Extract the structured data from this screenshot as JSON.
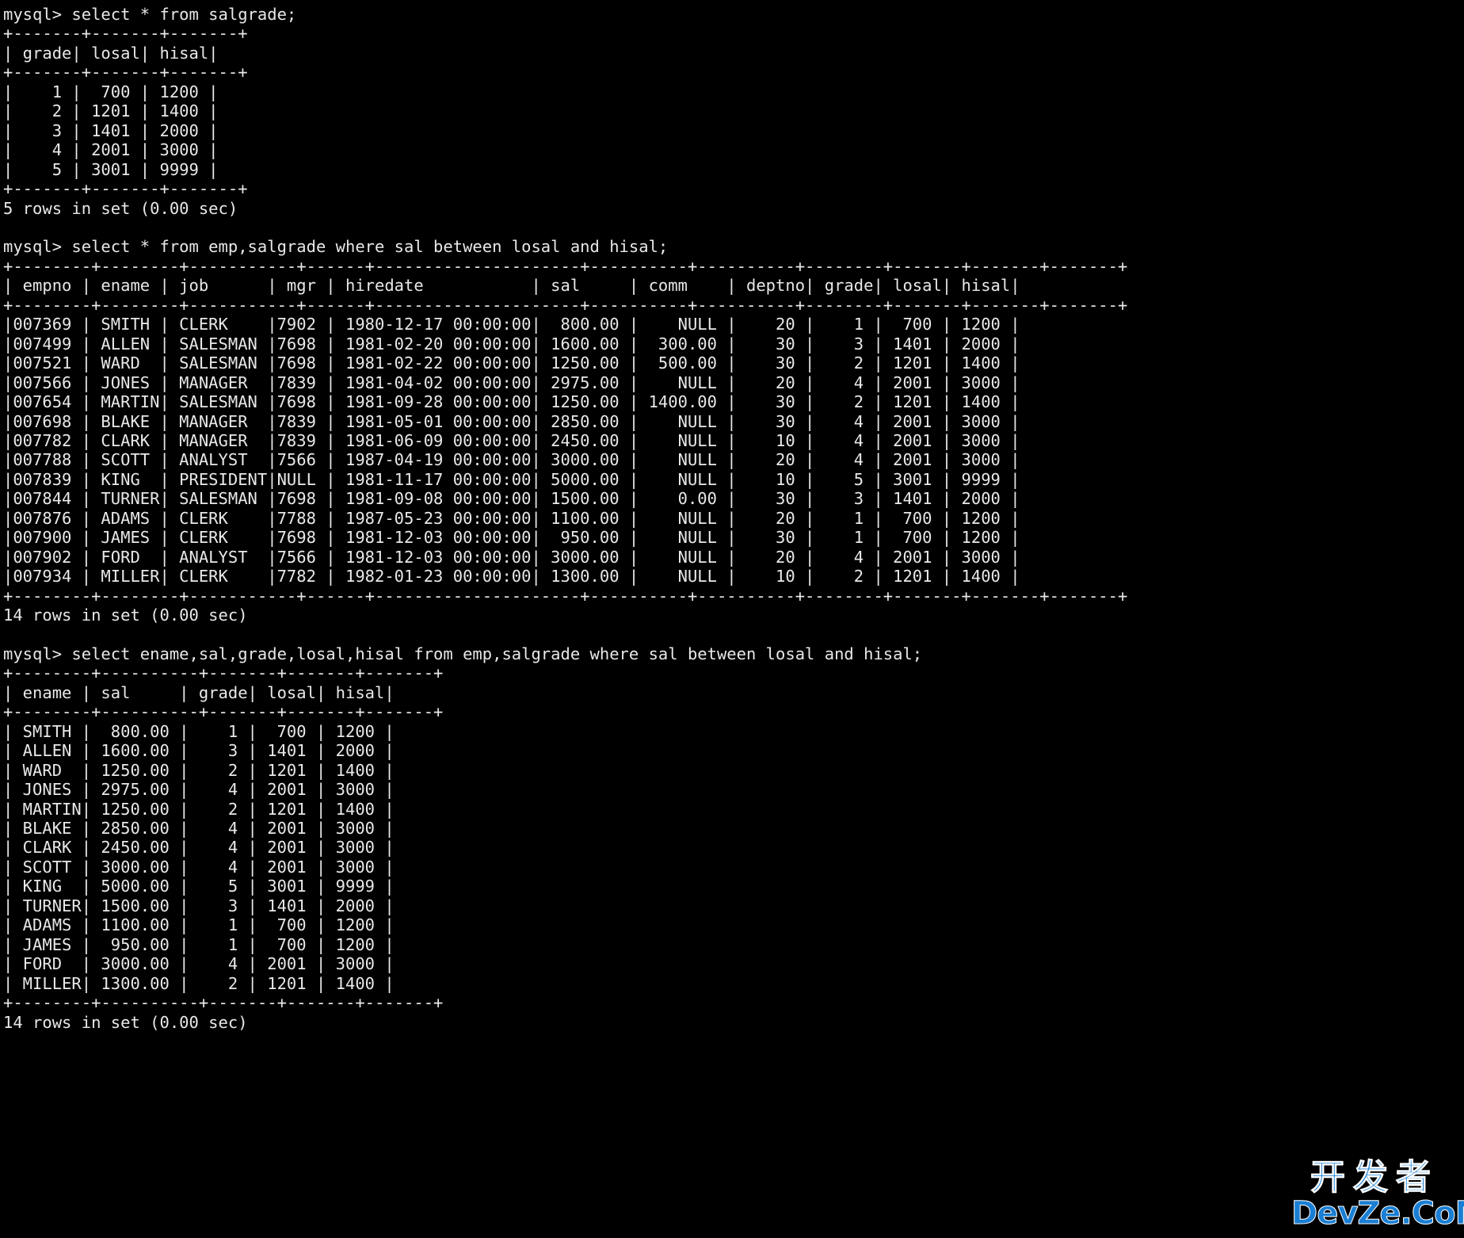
{
  "terminal": {
    "prompt": "mysql> ",
    "background_color": "#000000",
    "foreground_color": "#e8e8e8"
  },
  "watermark": {
    "chinese_text": "开发者",
    "latin_text": "DevZe.CoM",
    "color": "#1a7fd4"
  },
  "blocks": [
    {
      "command": "mysql> select * from salgrade;",
      "table": {
        "columns": [
          "grade",
          "losal",
          "hisal"
        ],
        "widths": [
          7,
          7,
          7
        ],
        "aligns": [
          "right",
          "right",
          "right"
        ],
        "rows": [
          [
            "1",
            "700",
            "1200"
          ],
          [
            "2",
            "1201",
            "1400"
          ],
          [
            "3",
            "1401",
            "2000"
          ],
          [
            "4",
            "2001",
            "3000"
          ],
          [
            "5",
            "3001",
            "9999"
          ]
        ]
      },
      "footer": "5 rows in set (0.00 sec)"
    },
    {
      "command": "mysql> select * from emp,salgrade where sal between losal and hisal;",
      "table": {
        "columns": [
          "empno",
          "ename",
          "job",
          "mgr",
          "hiredate",
          "sal",
          "comm",
          "deptno",
          "grade",
          "losal",
          "hisal"
        ],
        "widths": [
          8,
          8,
          11,
          6,
          21,
          10,
          10,
          8,
          7,
          7,
          7
        ],
        "aligns": [
          "right",
          "left",
          "left",
          "right",
          "left",
          "right",
          "right",
          "right",
          "right",
          "right",
          "right"
        ],
        "rows": [
          [
            "007369",
            "SMITH",
            "CLERK",
            "7902",
            "1980-12-17 00:00:00",
            "800.00",
            "NULL",
            "20",
            "1",
            "700",
            "1200"
          ],
          [
            "007499",
            "ALLEN",
            "SALESMAN",
            "7698",
            "1981-02-20 00:00:00",
            "1600.00",
            "300.00",
            "30",
            "3",
            "1401",
            "2000"
          ],
          [
            "007521",
            "WARD",
            "SALESMAN",
            "7698",
            "1981-02-22 00:00:00",
            "1250.00",
            "500.00",
            "30",
            "2",
            "1201",
            "1400"
          ],
          [
            "007566",
            "JONES",
            "MANAGER",
            "7839",
            "1981-04-02 00:00:00",
            "2975.00",
            "NULL",
            "20",
            "4",
            "2001",
            "3000"
          ],
          [
            "007654",
            "MARTIN",
            "SALESMAN",
            "7698",
            "1981-09-28 00:00:00",
            "1250.00",
            "1400.00",
            "30",
            "2",
            "1201",
            "1400"
          ],
          [
            "007698",
            "BLAKE",
            "MANAGER",
            "7839",
            "1981-05-01 00:00:00",
            "2850.00",
            "NULL",
            "30",
            "4",
            "2001",
            "3000"
          ],
          [
            "007782",
            "CLARK",
            "MANAGER",
            "7839",
            "1981-06-09 00:00:00",
            "2450.00",
            "NULL",
            "10",
            "4",
            "2001",
            "3000"
          ],
          [
            "007788",
            "SCOTT",
            "ANALYST",
            "7566",
            "1987-04-19 00:00:00",
            "3000.00",
            "NULL",
            "20",
            "4",
            "2001",
            "3000"
          ],
          [
            "007839",
            "KING",
            "PRESIDENT",
            "NULL",
            "1981-11-17 00:00:00",
            "5000.00",
            "NULL",
            "10",
            "5",
            "3001",
            "9999"
          ],
          [
            "007844",
            "TURNER",
            "SALESMAN",
            "7698",
            "1981-09-08 00:00:00",
            "1500.00",
            "0.00",
            "30",
            "3",
            "1401",
            "2000"
          ],
          [
            "007876",
            "ADAMS",
            "CLERK",
            "7788",
            "1987-05-23 00:00:00",
            "1100.00",
            "NULL",
            "20",
            "1",
            "700",
            "1200"
          ],
          [
            "007900",
            "JAMES",
            "CLERK",
            "7698",
            "1981-12-03 00:00:00",
            "950.00",
            "NULL",
            "30",
            "1",
            "700",
            "1200"
          ],
          [
            "007902",
            "FORD",
            "ANALYST",
            "7566",
            "1981-12-03 00:00:00",
            "3000.00",
            "NULL",
            "20",
            "4",
            "2001",
            "3000"
          ],
          [
            "007934",
            "MILLER",
            "CLERK",
            "7782",
            "1982-01-23 00:00:00",
            "1300.00",
            "NULL",
            "10",
            "2",
            "1201",
            "1400"
          ]
        ]
      },
      "footer": "14 rows in set (0.00 sec)"
    },
    {
      "command": "mysql> select ename,sal,grade,losal,hisal from emp,salgrade where sal between losal and hisal;",
      "table": {
        "columns": [
          "ename",
          "sal",
          "grade",
          "losal",
          "hisal"
        ],
        "widths": [
          8,
          10,
          7,
          7,
          7
        ],
        "aligns": [
          "left",
          "right",
          "right",
          "right",
          "right"
        ],
        "rows": [
          [
            "SMITH",
            "800.00",
            "1",
            "700",
            "1200"
          ],
          [
            "ALLEN",
            "1600.00",
            "3",
            "1401",
            "2000"
          ],
          [
            "WARD",
            "1250.00",
            "2",
            "1201",
            "1400"
          ],
          [
            "JONES",
            "2975.00",
            "4",
            "2001",
            "3000"
          ],
          [
            "MARTIN",
            "1250.00",
            "2",
            "1201",
            "1400"
          ],
          [
            "BLAKE",
            "2850.00",
            "4",
            "2001",
            "3000"
          ],
          [
            "CLARK",
            "2450.00",
            "4",
            "2001",
            "3000"
          ],
          [
            "SCOTT",
            "3000.00",
            "4",
            "2001",
            "3000"
          ],
          [
            "KING",
            "5000.00",
            "5",
            "3001",
            "9999"
          ],
          [
            "TURNER",
            "1500.00",
            "3",
            "1401",
            "2000"
          ],
          [
            "ADAMS",
            "1100.00",
            "1",
            "700",
            "1200"
          ],
          [
            "JAMES",
            "950.00",
            "1",
            "700",
            "1200"
          ],
          [
            "FORD",
            "3000.00",
            "4",
            "2001",
            "3000"
          ],
          [
            "MILLER",
            "1300.00",
            "2",
            "1201",
            "1400"
          ]
        ]
      },
      "footer": "14 rows in set (0.00 sec)"
    }
  ]
}
